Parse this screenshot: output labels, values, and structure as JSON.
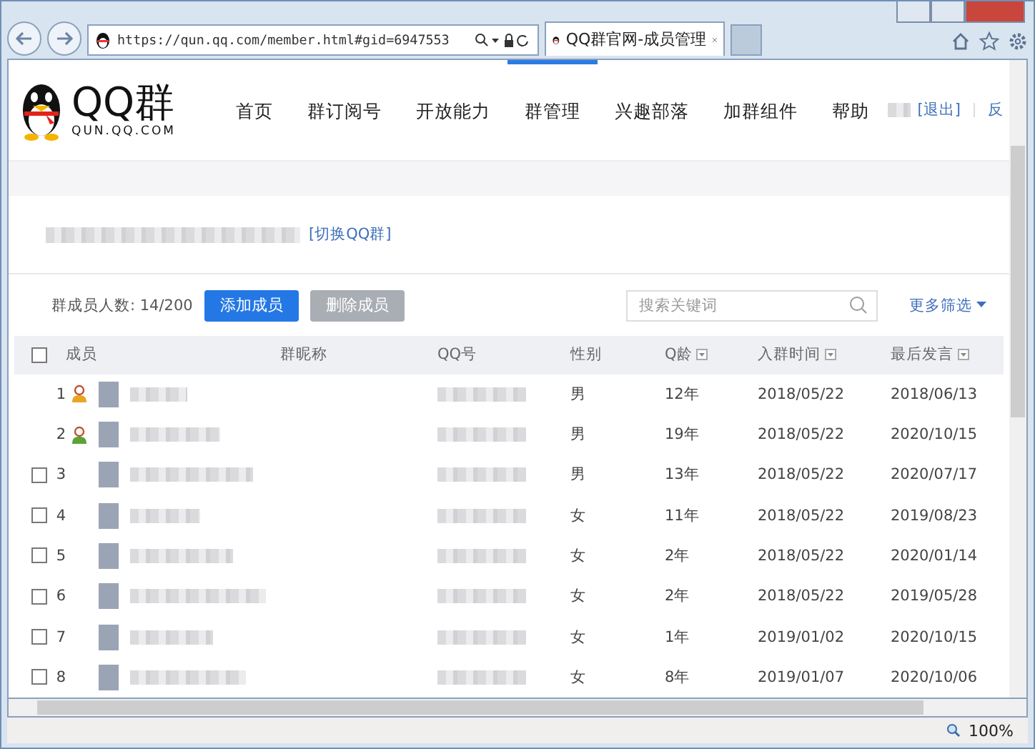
{
  "browser": {
    "url": "https://qun.qq.com/member.html#gid=6947553",
    "tab_title": "QQ群官网-成员管理",
    "zoom": "100%"
  },
  "header": {
    "logo_text": "QQ群",
    "logo_sub": "QUN.QQ.COM",
    "logout": "[退出]",
    "feedback": "反",
    "nav": [
      {
        "label": "首页",
        "selected": false
      },
      {
        "label": "群订阅号",
        "selected": false
      },
      {
        "label": "开放能力",
        "selected": false
      },
      {
        "label": "群管理",
        "selected": true
      },
      {
        "label": "兴趣部落",
        "selected": false
      },
      {
        "label": "加群组件",
        "selected": false
      },
      {
        "label": "帮助",
        "selected": false
      }
    ]
  },
  "group": {
    "switch_link": "[切换QQ群]"
  },
  "toolbar": {
    "count_label": "群成员人数: 14/200",
    "add_button": "添加成员",
    "remove_button": {
      "label": "删除成员",
      "disabled": true
    },
    "search": {
      "placeholder": "搜索关键词"
    },
    "filter": "更多筛选"
  },
  "table": {
    "header_checked": false,
    "columns": [
      {
        "label": "成员",
        "sortable": false
      },
      {
        "label": "群昵称",
        "sortable": false
      },
      {
        "label": "QQ号",
        "sortable": false
      },
      {
        "label": "性别",
        "sortable": false
      },
      {
        "label": "Q龄",
        "sortable": true
      },
      {
        "label": "入群时间",
        "sortable": true
      },
      {
        "label": "最后发言",
        "sortable": true
      }
    ],
    "rows": [
      {
        "kind": "owner",
        "index": "1",
        "gender": "男",
        "age": "12年",
        "joined": "2018/05/22",
        "last": "2018/06/13"
      },
      {
        "kind": "admin",
        "index": "2",
        "gender": "男",
        "age": "19年",
        "joined": "2018/05/22",
        "last": "2020/10/15"
      },
      {
        "kind": "member",
        "checked": false,
        "index": "3",
        "gender": "男",
        "age": "13年",
        "joined": "2018/05/22",
        "last": "2020/07/17"
      },
      {
        "kind": "member",
        "checked": false,
        "index": "4",
        "gender": "女",
        "age": "11年",
        "joined": "2018/05/22",
        "last": "2019/08/23"
      },
      {
        "kind": "member",
        "checked": false,
        "index": "5",
        "gender": "女",
        "age": "2年",
        "joined": "2018/05/22",
        "last": "2020/01/14"
      },
      {
        "kind": "member",
        "checked": false,
        "index": "6",
        "gender": "女",
        "age": "2年",
        "joined": "2018/05/22",
        "last": "2019/05/28"
      },
      {
        "kind": "member",
        "checked": false,
        "index": "7",
        "gender": "女",
        "age": "1年",
        "joined": "2019/01/02",
        "last": "2020/10/15"
      },
      {
        "kind": "member",
        "checked": false,
        "index": "8",
        "gender": "女",
        "age": "8年",
        "joined": "2019/01/07",
        "last": "2020/10/06"
      }
    ]
  }
}
